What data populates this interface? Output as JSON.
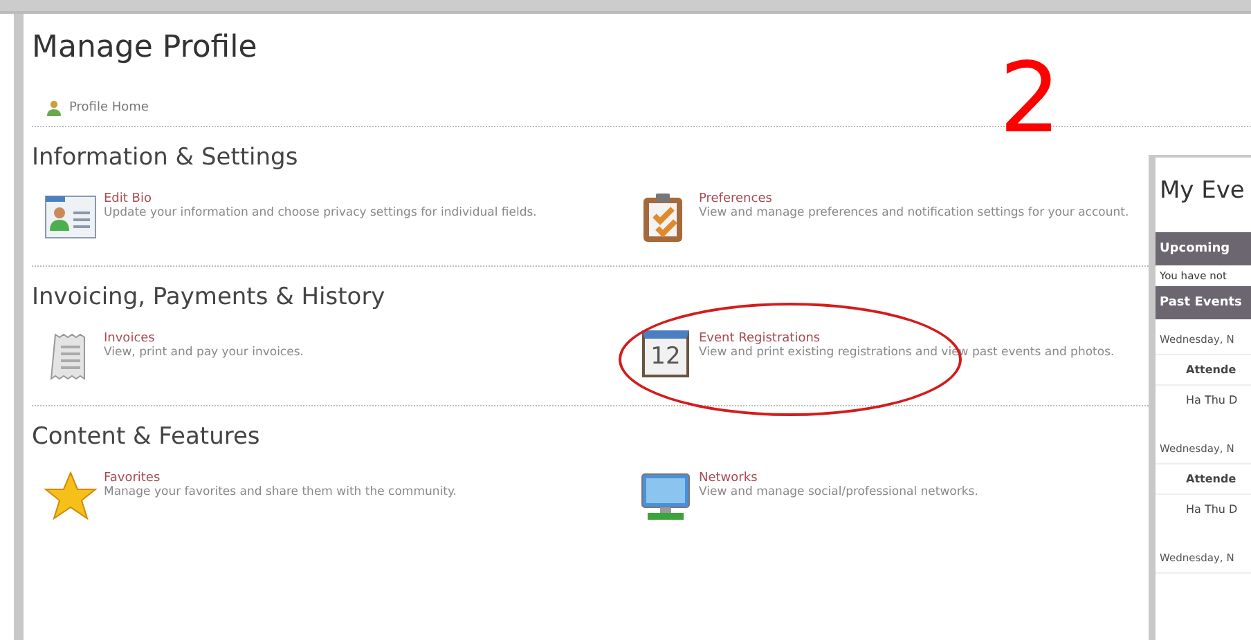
{
  "title": "Manage Profile",
  "home_link": "Profile Home",
  "annotation": "2",
  "sections": [
    {
      "heading": "Information & Settings",
      "items": [
        {
          "kind": "bio",
          "title": "Edit Bio",
          "description": "Update your information and choose privacy settings for individual fields.",
          "highlighted": false
        },
        {
          "kind": "preferences",
          "title": "Preferences",
          "description": "View and manage preferences and notification settings for your account.",
          "highlighted": false
        }
      ]
    },
    {
      "heading": "Invoicing, Payments & History",
      "items": [
        {
          "kind": "invoice",
          "title": "Invoices",
          "description": "View, print and pay your invoices.",
          "highlighted": false
        },
        {
          "kind": "calendar",
          "title": "Event Registrations",
          "description": "View and print existing registrations and view past events and photos.",
          "icon_text": "12",
          "highlighted": true
        }
      ]
    },
    {
      "heading": "Content & Features",
      "items": [
        {
          "kind": "star",
          "title": "Favorites",
          "description": "Manage your favorites and share them with the community.",
          "highlighted": false
        },
        {
          "kind": "monitor",
          "title": "Networks",
          "description": "View and manage social/professional networks.",
          "highlighted": false
        }
      ]
    }
  ],
  "events_panel": {
    "title": "My Eve",
    "upcoming_header": "Upcoming",
    "upcoming_text": "You have not",
    "past_header": "Past Events",
    "rows": [
      {
        "kind": "date",
        "text": "Wednesday, N"
      },
      {
        "kind": "label",
        "text": "Attende"
      },
      {
        "kind": "name",
        "text": "Ha Thu D"
      },
      {
        "kind": "date",
        "text": "Wednesday, N"
      },
      {
        "kind": "label",
        "text": "Attende"
      },
      {
        "kind": "name",
        "text": "Ha Thu D"
      },
      {
        "kind": "date",
        "text": "Wednesday, N"
      }
    ]
  }
}
